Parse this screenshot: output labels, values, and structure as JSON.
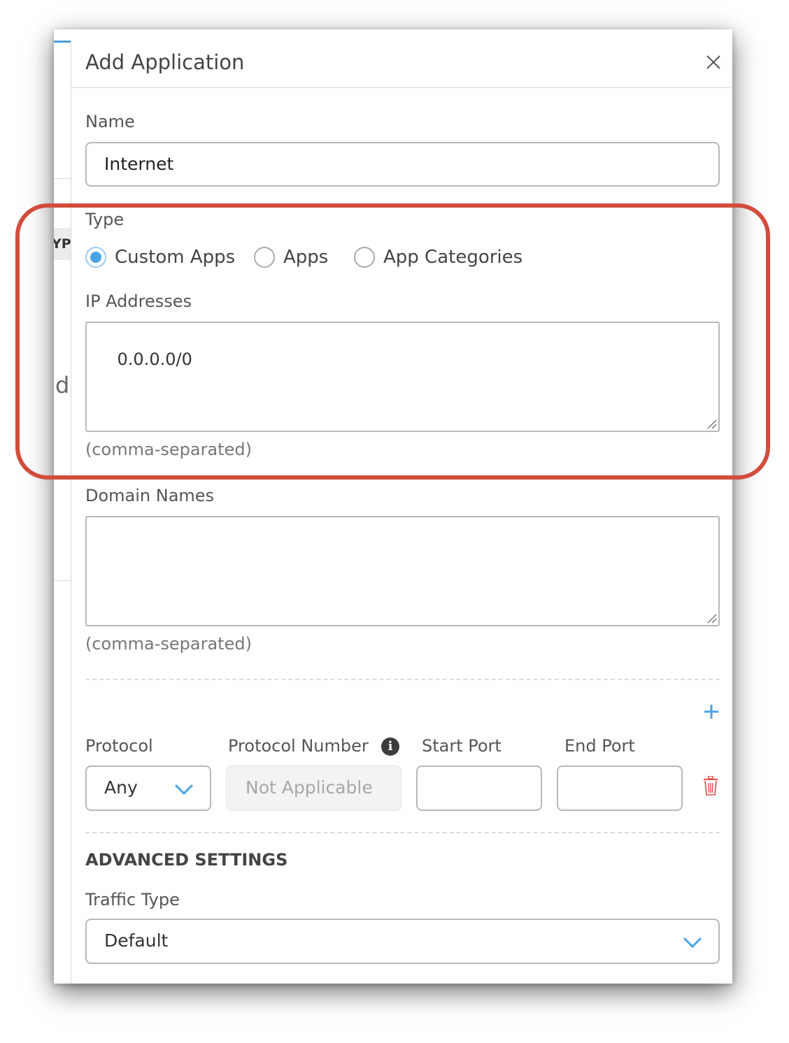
{
  "background": {
    "column_tag": "YP",
    "truncated_letter": "d"
  },
  "modal": {
    "title": "Add Application",
    "close_icon": "close-icon"
  },
  "form": {
    "name_label": "Name",
    "name_value": "Internet",
    "type_label": "Type",
    "type_options": [
      {
        "label": "Custom Apps",
        "selected": true
      },
      {
        "label": "Apps",
        "selected": false
      },
      {
        "label": "App Categories",
        "selected": false
      }
    ],
    "ip_label": "IP Addresses",
    "ip_value": "0.0.0.0/0",
    "ip_hint": "(comma-separated)",
    "domain_label": "Domain Names",
    "domain_value": "",
    "domain_hint": "(comma-separated)"
  },
  "port_rules": {
    "add_icon": "plus-icon",
    "protocol_label": "Protocol",
    "protocol_value": "Any",
    "protocol_number_label": "Protocol Number",
    "protocol_number_icon": "info-icon",
    "protocol_number_placeholder": "Not Applicable",
    "start_port_label": "Start Port",
    "start_port_value": "",
    "end_port_label": "End Port",
    "end_port_value": "",
    "delete_icon": "trash-icon"
  },
  "advanced": {
    "title": "ADVANCED SETTINGS",
    "traffic_type_label": "Traffic Type",
    "traffic_type_value": "Default"
  },
  "colors": {
    "accent": "#4aa3e6",
    "highlight": "#d24d3d",
    "delete": "#e0504a"
  }
}
